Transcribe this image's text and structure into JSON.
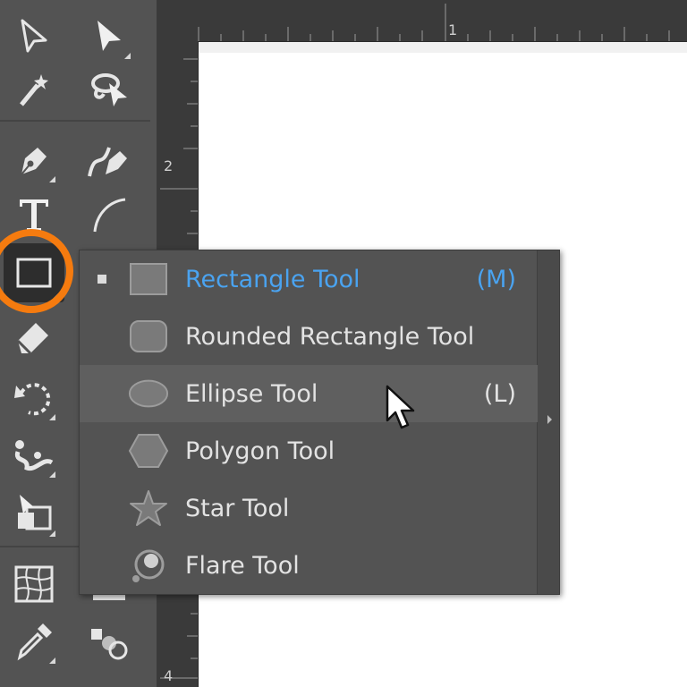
{
  "rulers": {
    "top_mark": "1",
    "left_mark_2": "2",
    "left_mark_4": "4"
  },
  "toolbar": {
    "tools": [
      {
        "name": "direct-selection-tool",
        "icon": "hollow-arrow-icon"
      },
      {
        "name": "selection-tool",
        "icon": "solid-arrow-icon"
      },
      {
        "name": "magic-wand-tool",
        "icon": "magic-wand-icon"
      },
      {
        "name": "lasso-tool",
        "icon": "lasso-icon"
      },
      {
        "name": "pen-tool",
        "icon": "pen-nib-icon"
      },
      {
        "name": "curvature-tool",
        "icon": "curvature-pen-icon"
      },
      {
        "name": "type-tool",
        "icon": "type-t-icon"
      },
      {
        "name": "line-segment-tool",
        "icon": "arc-icon"
      },
      {
        "name": "rectangle-tool",
        "icon": "rectangle-icon",
        "active": true
      },
      {
        "name": "eraser-tool",
        "icon": "eraser-icon"
      },
      {
        "name": "rotate-tool",
        "icon": "rotate-icon"
      },
      {
        "name": "puppet-warp-tool",
        "icon": "puppet-warp-icon"
      },
      {
        "name": "shape-builder-tool",
        "icon": "shape-builder-icon"
      },
      {
        "name": "mesh-tool",
        "icon": "mesh-icon"
      },
      {
        "name": "eyedropper-tool",
        "icon": "eyedropper-icon"
      },
      {
        "name": "blend-tool",
        "icon": "blend-icon"
      }
    ]
  },
  "flyout": {
    "items": [
      {
        "label": "Rectangle Tool",
        "shortcut": "(M)",
        "icon": "rectangle-icon",
        "active": true
      },
      {
        "label": "Rounded Rectangle Tool",
        "shortcut": "",
        "icon": "rounded-rectangle-icon"
      },
      {
        "label": "Ellipse Tool",
        "shortcut": "(L)",
        "icon": "ellipse-icon",
        "hover": true
      },
      {
        "label": "Polygon Tool",
        "shortcut": "",
        "icon": "hexagon-icon"
      },
      {
        "label": "Star Tool",
        "shortcut": "",
        "icon": "star-icon"
      },
      {
        "label": "Flare Tool",
        "shortcut": "",
        "icon": "flare-icon"
      }
    ]
  },
  "colors": {
    "panel": "#535353",
    "active_text": "#4aa3f0",
    "highlight_ring": "#f57b0f",
    "canvas": "#ffffff"
  }
}
